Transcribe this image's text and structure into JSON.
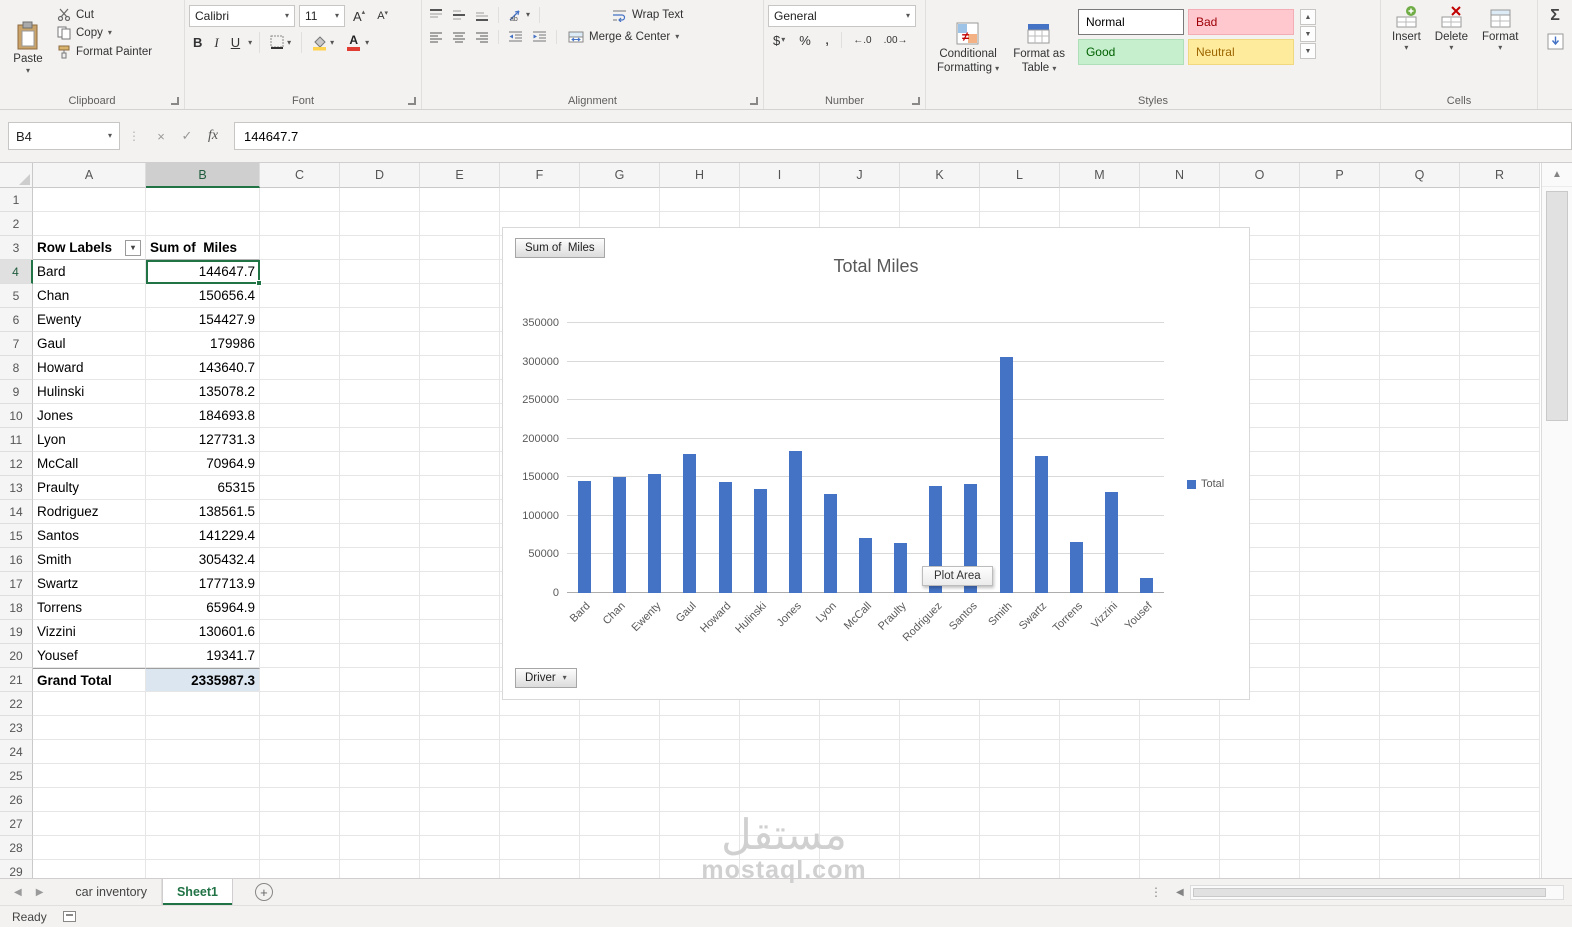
{
  "ribbon": {
    "clipboard": {
      "label": "Clipboard",
      "paste": "Paste",
      "cut": "Cut",
      "copy": "Copy",
      "format_painter": "Format Painter"
    },
    "font": {
      "label": "Font",
      "name": "Calibri",
      "size": "11",
      "bold": "B",
      "italic": "I",
      "underline": "U"
    },
    "alignment": {
      "label": "Alignment",
      "wrap_text": "Wrap Text",
      "merge_center": "Merge & Center"
    },
    "number": {
      "label": "Number",
      "format": "General",
      "currency": "$",
      "percent": "%",
      "comma": ",",
      "increase_decimal": "←.0",
      "decrease_decimal": ".00→"
    },
    "styles": {
      "label": "Styles",
      "conditional_line1": "Conditional",
      "conditional_line2": "Formatting",
      "format_table_line1": "Format as",
      "format_table_line2": "Table",
      "gallery": [
        "Normal",
        "Bad",
        "Good",
        "Neutral"
      ]
    },
    "cells": {
      "label": "Cells",
      "insert": "Insert",
      "delete": "Delete",
      "format": "Format"
    },
    "editing": {
      "autosum": "Σ"
    }
  },
  "formula_bar": {
    "name_box": "B4",
    "cancel": "×",
    "enter": "✓",
    "fx": "fx",
    "value": "144647.7"
  },
  "grid": {
    "columns": [
      "A",
      "B",
      "C",
      "D",
      "E",
      "F",
      "G",
      "H",
      "I",
      "J",
      "K",
      "L",
      "M",
      "N",
      "O",
      "P",
      "Q",
      "R"
    ],
    "row_count": 29,
    "selected_cell": "B4",
    "selected_column": "B",
    "selected_row": 4
  },
  "pivot": {
    "header_row": 3,
    "header": [
      "Row Labels",
      "Sum of  Miles"
    ],
    "rows": [
      [
        "Bard",
        "144647.7"
      ],
      [
        "Chan",
        "150656.4"
      ],
      [
        "Ewenty",
        "154427.9"
      ],
      [
        "Gaul",
        "179986"
      ],
      [
        "Howard",
        "143640.7"
      ],
      [
        "Hulinski",
        "135078.2"
      ],
      [
        "Jones",
        "184693.8"
      ],
      [
        "Lyon",
        "127731.3"
      ],
      [
        "McCall",
        "70964.9"
      ],
      [
        "Praulty",
        "65315"
      ],
      [
        "Rodriguez",
        "138561.5"
      ],
      [
        "Santos",
        "141229.4"
      ],
      [
        "Smith",
        "305432.4"
      ],
      [
        "Swartz",
        "177713.9"
      ],
      [
        "Torrens",
        "65964.9"
      ],
      [
        "Vizzini",
        "130601.6"
      ],
      [
        "Yousef",
        "19341.7"
      ]
    ],
    "grand_total": [
      "Grand Total",
      "2335987.3"
    ]
  },
  "chart_data": {
    "type": "bar",
    "title": "Total Miles",
    "categories": [
      "Bard",
      "Chan",
      "Ewenty",
      "Gaul",
      "Howard",
      "Hulinski",
      "Jones",
      "Lyon",
      "McCall",
      "Praulty",
      "Rodriguez",
      "Santos",
      "Smith",
      "Swartz",
      "Torrens",
      "Vizzini",
      "Yousef"
    ],
    "series": [
      {
        "name": "Total",
        "values": [
          144647.7,
          150656.4,
          154427.9,
          179986,
          143640.7,
          135078.2,
          184693.8,
          127731.3,
          70964.9,
          65315,
          138561.5,
          141229.4,
          305432.4,
          177713.9,
          65964.9,
          130601.6,
          19341.7
        ]
      }
    ],
    "ylim": [
      0,
      350000
    ],
    "ytick_step": 50000,
    "grid": true,
    "legend_position": "right",
    "bar_color": "#4472c4",
    "field_button": "Sum of  Miles",
    "axis_field_button": "Driver",
    "tooltip": "Plot Area"
  },
  "sheet_tabs": {
    "tabs": [
      "car inventory",
      "Sheet1"
    ],
    "active": "Sheet1"
  },
  "status_bar": {
    "status": "Ready"
  },
  "watermark": {
    "line1": "مستقل",
    "line2": "mostaql.com"
  },
  "colors": {
    "excel_green": "#217346",
    "bar_blue": "#4472c4",
    "bad_bg": "#ffc7ce",
    "bad_text": "#9c0006",
    "good_bg": "#c6efce",
    "good_text": "#006100",
    "neutral_bg": "#ffeb9c",
    "neutral_text": "#9c6500"
  }
}
